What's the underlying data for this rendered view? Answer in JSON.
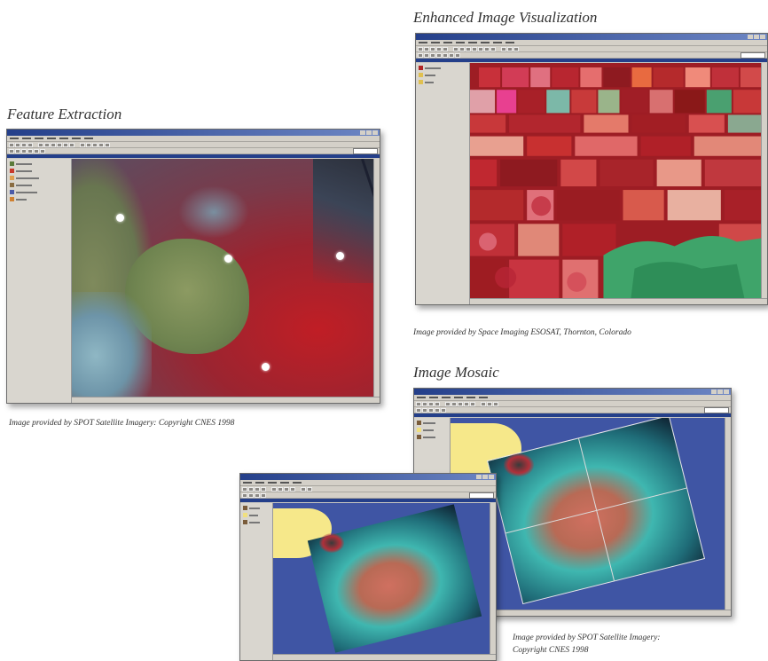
{
  "panels": {
    "feature_extraction": {
      "heading": "Feature Extraction",
      "caption": "Image provided by SPOT Satellite Imagery: Copyright CNES 1998"
    },
    "enhanced_visualization": {
      "heading": "Enhanced Image Visualization",
      "caption": "Image provided by Space Imaging ESOSAT, Thornton, Colorado"
    },
    "image_mosaic": {
      "heading": "Image Mosaic",
      "caption_line1": "Image provided by SPOT Satellite Imagery:",
      "caption_line2": "Copyright CNES 1998"
    }
  },
  "colors": {
    "titlebar": "#243f8a",
    "window_chrome": "#d4d0c8",
    "map_background": "#3f55a4",
    "land_yellow": "#f6e88a",
    "vegetation_red": "#b52a2c",
    "forest_green": "#7b8f54"
  }
}
